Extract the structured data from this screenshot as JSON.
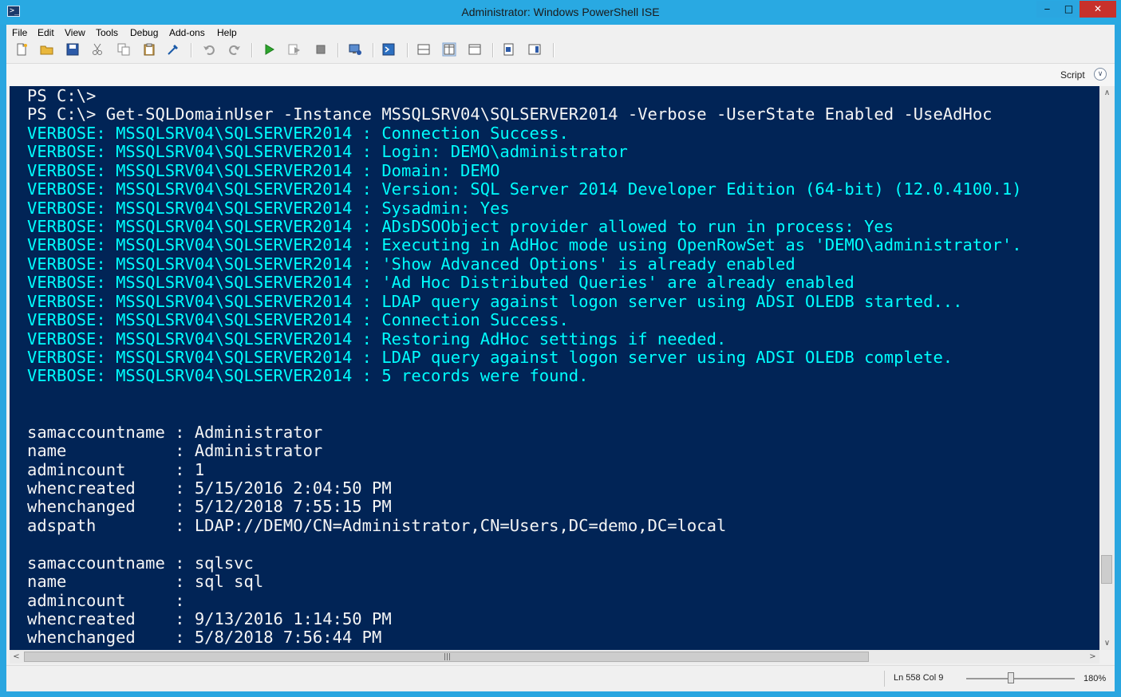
{
  "window": {
    "title": "Administrator: Windows PowerShell ISE",
    "min_symbol": "‒",
    "max_symbol": "□",
    "close_symbol": "✕"
  },
  "menu": [
    "File",
    "Edit",
    "View",
    "Tools",
    "Debug",
    "Add-ons",
    "Help"
  ],
  "toolbar": {
    "icons": [
      "new-file-icon",
      "open-folder-icon",
      "save-icon",
      "cut-icon",
      "copy-icon",
      "paste-icon",
      "clear-console-icon",
      "undo-icon",
      "redo-icon",
      "run-script-icon",
      "run-selection-icon",
      "stop-icon",
      "remote-powershell-icon",
      "start-powershell-icon",
      "show-script-top-icon",
      "show-script-right-icon",
      "show-script-maximized-icon",
      "show-command-window-icon",
      "show-command-addon-icon"
    ]
  },
  "pane": {
    "script_label": "Script",
    "toggle_symbol": "∨"
  },
  "console": {
    "lines": [
      {
        "text": "PS C:\\>",
        "color": "#f5f5f5"
      },
      {
        "text": "PS C:\\> Get-SQLDomainUser -Instance MSSQLSRV04\\SQLSERVER2014 -Verbose -UserState Enabled -UseAdHoc",
        "color": "#f5f5f5"
      },
      {
        "text": "VERBOSE: MSSQLSRV04\\SQLSERVER2014 : Connection Success.",
        "color": "#00ffff"
      },
      {
        "text": "VERBOSE: MSSQLSRV04\\SQLSERVER2014 : Login: DEMO\\administrator",
        "color": "#00ffff"
      },
      {
        "text": "VERBOSE: MSSQLSRV04\\SQLSERVER2014 : Domain: DEMO",
        "color": "#00ffff"
      },
      {
        "text": "VERBOSE: MSSQLSRV04\\SQLSERVER2014 : Version: SQL Server 2014 Developer Edition (64-bit) (12.0.4100.1)",
        "color": "#00ffff"
      },
      {
        "text": "VERBOSE: MSSQLSRV04\\SQLSERVER2014 : Sysadmin: Yes",
        "color": "#00ffff"
      },
      {
        "text": "VERBOSE: MSSQLSRV04\\SQLSERVER2014 : ADsDSOObject provider allowed to run in process: Yes",
        "color": "#00ffff"
      },
      {
        "text": "VERBOSE: MSSQLSRV04\\SQLSERVER2014 : Executing in AdHoc mode using OpenRowSet as 'DEMO\\administrator'.",
        "color": "#00ffff"
      },
      {
        "text": "VERBOSE: MSSQLSRV04\\SQLSERVER2014 : 'Show Advanced Options' is already enabled",
        "color": "#00ffff"
      },
      {
        "text": "VERBOSE: MSSQLSRV04\\SQLSERVER2014 : 'Ad Hoc Distributed Queries' are already enabled",
        "color": "#00ffff"
      },
      {
        "text": "VERBOSE: MSSQLSRV04\\SQLSERVER2014 : LDAP query against logon server using ADSI OLEDB started...",
        "color": "#00ffff"
      },
      {
        "text": "VERBOSE: MSSQLSRV04\\SQLSERVER2014 : Connection Success.",
        "color": "#00ffff"
      },
      {
        "text": "VERBOSE: MSSQLSRV04\\SQLSERVER2014 : Restoring AdHoc settings if needed.",
        "color": "#00ffff"
      },
      {
        "text": "VERBOSE: MSSQLSRV04\\SQLSERVER2014 : LDAP query against logon server using ADSI OLEDB complete.",
        "color": "#00ffff"
      },
      {
        "text": "VERBOSE: MSSQLSRV04\\SQLSERVER2014 : 5 records were found.",
        "color": "#00ffff"
      },
      {
        "text": "",
        "color": "#f5f5f5"
      },
      {
        "text": "",
        "color": "#f5f5f5"
      },
      {
        "text": "samaccountname : Administrator",
        "color": "#f5f5f5"
      },
      {
        "text": "name           : Administrator",
        "color": "#f5f5f5"
      },
      {
        "text": "admincount     : 1",
        "color": "#f5f5f5"
      },
      {
        "text": "whencreated    : 5/15/2016 2:04:50 PM",
        "color": "#f5f5f5"
      },
      {
        "text": "whenchanged    : 5/12/2018 7:55:15 PM",
        "color": "#f5f5f5"
      },
      {
        "text": "adspath        : LDAP://DEMO/CN=Administrator,CN=Users,DC=demo,DC=local",
        "color": "#f5f5f5"
      },
      {
        "text": "",
        "color": "#f5f5f5"
      },
      {
        "text": "samaccountname : sqlsvc",
        "color": "#f5f5f5"
      },
      {
        "text": "name           : sql sql",
        "color": "#f5f5f5"
      },
      {
        "text": "admincount     :",
        "color": "#f5f5f5"
      },
      {
        "text": "whencreated    : 9/13/2016 1:14:50 PM",
        "color": "#f5f5f5"
      },
      {
        "text": "whenchanged    : 5/8/2018 7:56:44 PM",
        "color": "#f5f5f5"
      }
    ]
  },
  "scroll": {
    "up": "∧",
    "down": "∨",
    "left": "<",
    "right": ">",
    "grip": "|||",
    "vgrip": "≡"
  },
  "status": {
    "position": "Ln 558  Col 9",
    "zoom": "180%"
  }
}
